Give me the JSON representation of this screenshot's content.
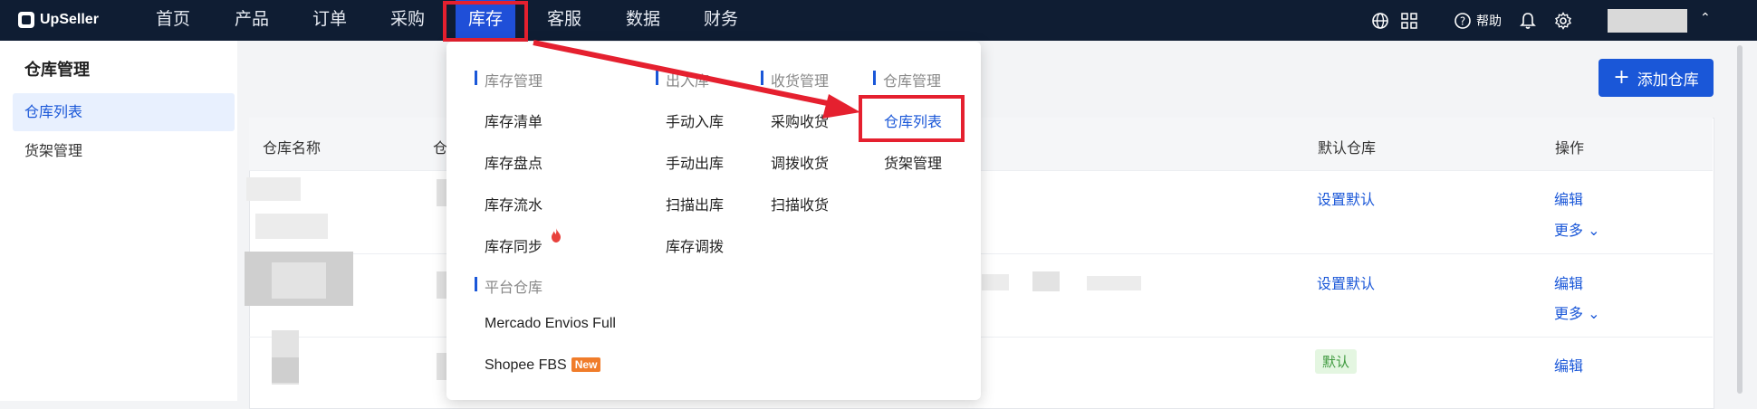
{
  "app": {
    "logo_text": "UpSeller"
  },
  "nav": {
    "items": [
      "首页",
      "产品",
      "订单",
      "采购",
      "库存",
      "客服",
      "数据",
      "财务"
    ],
    "active": "库存"
  },
  "topright": {
    "help_label": "帮助",
    "icons": [
      "globe-icon",
      "apps-icon",
      "help-icon",
      "bell-icon",
      "gear-icon"
    ]
  },
  "sidebar": {
    "title": "仓库管理",
    "items": [
      {
        "label": "仓库列表",
        "active": true
      },
      {
        "label": "货架管理",
        "active": false
      }
    ]
  },
  "page": {
    "add_button_label": "添加仓库"
  },
  "table": {
    "columns": [
      "仓库名称",
      "仓",
      "默认仓库",
      "操作"
    ],
    "rows": [
      {
        "default_action": "设置默认",
        "edit": "编辑",
        "more": "更多"
      },
      {
        "default_action": "设置默认",
        "edit": "编辑",
        "more": "更多"
      },
      {
        "default_badge": "默认",
        "edit": "编辑"
      }
    ]
  },
  "dropdown": {
    "groups": [
      {
        "title": "库存管理",
        "items": [
          "库存清单",
          "库存盘点",
          "库存流水",
          "库存同步"
        ]
      },
      {
        "title": "出入库",
        "items": [
          "手动入库",
          "手动出库",
          "扫描出库",
          "库存调拨"
        ]
      },
      {
        "title": "收货管理",
        "items": [
          "采购收货",
          "调拨收货",
          "扫描收货"
        ]
      },
      {
        "title": "仓库管理",
        "items": [
          "仓库列表",
          "货架管理"
        ],
        "highlighted": "仓库列表"
      },
      {
        "title": "平台仓库",
        "items": [
          "Mercado Envios Full",
          "Shopee FBS"
        ]
      }
    ],
    "new_badge": "New"
  },
  "colors": {
    "topbar": "#0f1d33",
    "accent": "#1a57d8",
    "highlight": "#e5202f"
  }
}
